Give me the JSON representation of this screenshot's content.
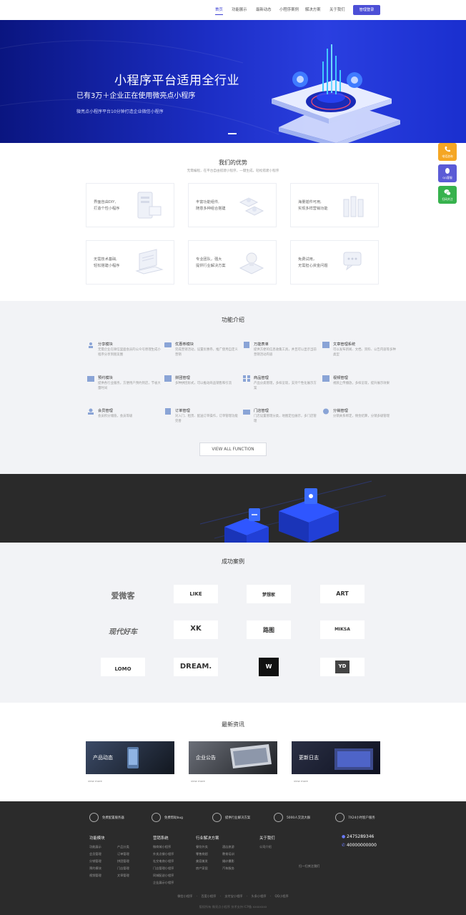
{
  "nav": {
    "items": [
      {
        "label": "首页",
        "active": true
      },
      {
        "label": "功能展示"
      },
      {
        "label": "最新动态"
      },
      {
        "label": "小程序案例"
      },
      {
        "label": "解决方案"
      },
      {
        "label": "关于我们"
      }
    ],
    "login": "管理登录"
  },
  "hero": {
    "title": "小程序平台适用全行业",
    "subtitle": "已有3万＋企业正在使用微亮点小程序",
    "desc": "微亮点小程序平台10分钟打造企业微信小程序"
  },
  "float": [
    {
      "label": "电话咨询",
      "color": "#f5a623",
      "icon": "phone-icon"
    },
    {
      "label": "QQ客服",
      "color": "#5b5bd6",
      "icon": "qq-icon"
    },
    {
      "label": "扫码关注",
      "color": "#37b24d",
      "icon": "wechat-icon"
    }
  ],
  "advantages": {
    "title": "我们的优势",
    "subtitle": "无需编程，在平台自由搭建小程序，一键生成，轻松搭建小程序",
    "items": [
      {
        "text": "界面自由DIY,\n打造个性小程序"
      },
      {
        "text": "丰富功能组件,\n随意多种组合搭建"
      },
      {
        "text": "海量插件可用,\n实现多样营销功能"
      },
      {
        "text": "无需技术基础,\n轻松搭建小程序"
      },
      {
        "text": "专业团队，强大\n提供行业解决方案"
      },
      {
        "text": "免费试用，\n无需担心资金问题"
      }
    ]
  },
  "features": {
    "title": "功能介绍",
    "items": [
      {
        "title": "分享模块",
        "desc": "无需企业在微信里面会员的公众号原理生成小程序分享到朋友圈"
      },
      {
        "title": "优惠券模块",
        "desc": "完成营销活动，设置优惠券，推广使用自定义营销"
      },
      {
        "title": "万能表单",
        "desc": "提供方便的信息收集工具，并且可以显示当前营销活动内容"
      },
      {
        "title": "文章管理系统",
        "desc": "可以发布新闻、文档、资料、公告内容等多种类型"
      },
      {
        "title": "预约模块",
        "desc": "提供各行业服务，方便用户预约到店，节省大量时间"
      },
      {
        "title": "拼团管理",
        "desc": "多种拼团形式，可以推动商品销售和引流"
      },
      {
        "title": "商品管理",
        "desc": "产品分类管理，多样呈现，支持个性化展示方案"
      },
      {
        "title": "视频管理",
        "desc": "视频上传播放，多样呈现，提升展示效果"
      },
      {
        "title": "会员管理",
        "desc": "会员积分储值，会员等级"
      },
      {
        "title": "订单管理",
        "desc": "对入门、租赁、配送订单操作，订单管理功能完善"
      },
      {
        "title": "门店管理",
        "desc": "门店设置管理分类，地图定位展示，多门店管理"
      },
      {
        "title": "分销管理",
        "desc": "分销关系绑定，佣金结算，分销多级管理"
      }
    ],
    "button": "VIEW ALL FUNCTION"
  },
  "cases": {
    "title": "成功案例",
    "logos": [
      {
        "text": "爱微客"
      },
      {
        "text": "LIKE"
      },
      {
        "text": "梦想家"
      },
      {
        "text": "ART"
      },
      {
        "text": "现代好车"
      },
      {
        "text": "XK"
      },
      {
        "text": "路图"
      },
      {
        "text": "MIKSA"
      },
      {
        "text": "LOMO"
      },
      {
        "text": "DREAM."
      },
      {
        "text": "W"
      },
      {
        "text": "YD"
      }
    ]
  },
  "news": {
    "title": "最新资讯",
    "cards": [
      {
        "label": "产品动态",
        "more": "view more"
      },
      {
        "label": "企业公告",
        "more": "view more"
      },
      {
        "label": "更新日志",
        "more": "view more"
      }
    ]
  },
  "footer": {
    "chips": [
      "免费配置服务器",
      "免费帮助bug",
      "提供行业解决方案",
      "5000人交流大群",
      "7X24小时客户服务"
    ],
    "columns": [
      {
        "title": "功能模块",
        "links": [
          "功能展示",
          "产品分类",
          "会员管理",
          "订单管理",
          "分销管理",
          "拼团管理",
          "预约模块",
          "门店管理",
          "视频管理",
          "文章管理"
        ]
      },
      {
        "title": "营销系统",
        "links": [
          "微商城小程序",
          "外卖点餐小程序",
          "社交电商小程序",
          "门店管理小程序",
          "同城配送小程序",
          "企业展示小程序"
        ]
      },
      {
        "title": "行业解决方案",
        "links": [
          "餐饮外卖",
          "酒店旅游",
          "零售商超",
          "教育培训",
          "美容美发",
          "婚纱摄影",
          "房产家居",
          "汽车服务"
        ]
      },
      {
        "title": "关于我们",
        "links": [
          "公司介绍"
        ]
      }
    ],
    "qq": "2475289346",
    "phone": "40000000000",
    "qr_label": "扫一扫关注我们",
    "bottom_links": [
      "微信小程序",
      "百度小程序",
      "支付宝小程序",
      "头条小程序",
      "QQ小程序"
    ],
    "copyright": "版权所有 微亮点小程序 技术支持 ICP备 xxxxxxxx"
  }
}
